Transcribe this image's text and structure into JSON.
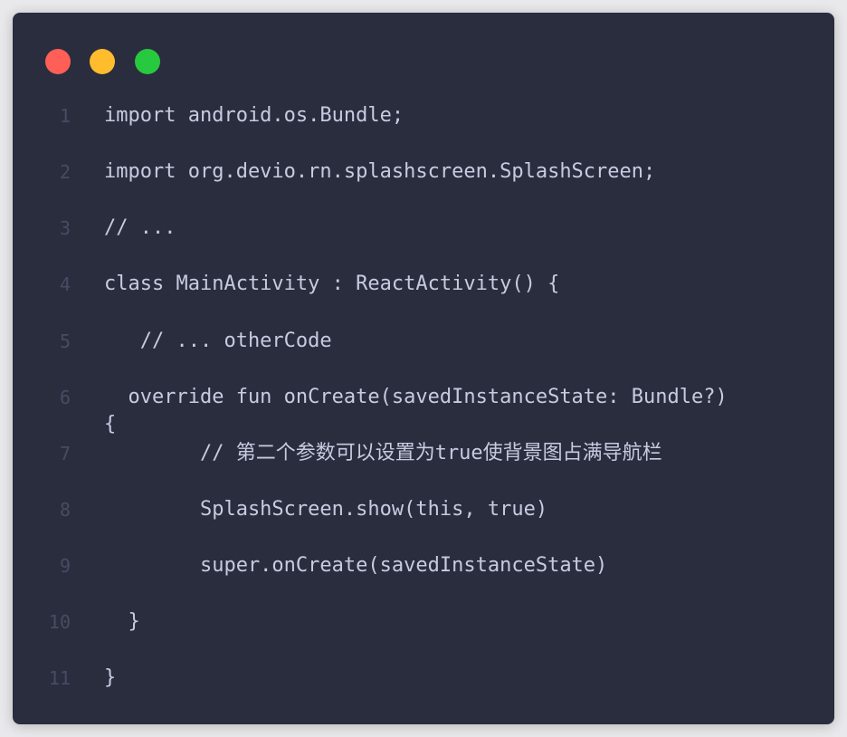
{
  "window": {
    "controls": [
      {
        "name": "close",
        "color": "#ff5f56"
      },
      {
        "name": "minimize",
        "color": "#ffbd2e"
      },
      {
        "name": "maximize",
        "color": "#27c93f"
      }
    ]
  },
  "code": {
    "lines": [
      {
        "number": "1",
        "text": "import android.os.Bundle;"
      },
      {
        "number": "2",
        "text": "import org.devio.rn.splashscreen.SplashScreen;"
      },
      {
        "number": "3",
        "text": "// ..."
      },
      {
        "number": "4",
        "text": "class MainActivity : ReactActivity() {"
      },
      {
        "number": "5",
        "text": "   // ... otherCode"
      },
      {
        "number": "6",
        "text": "  override fun onCreate(savedInstanceState: Bundle?)\n{"
      },
      {
        "number": "7",
        "text": "        // 第二个参数可以设置为true使背景图占满导航栏"
      },
      {
        "number": "8",
        "text": "        SplashScreen.show(this, true)"
      },
      {
        "number": "9",
        "text": "        super.onCreate(savedInstanceState)"
      },
      {
        "number": "10",
        "text": "  }"
      },
      {
        "number": "11",
        "text": "}"
      }
    ]
  }
}
